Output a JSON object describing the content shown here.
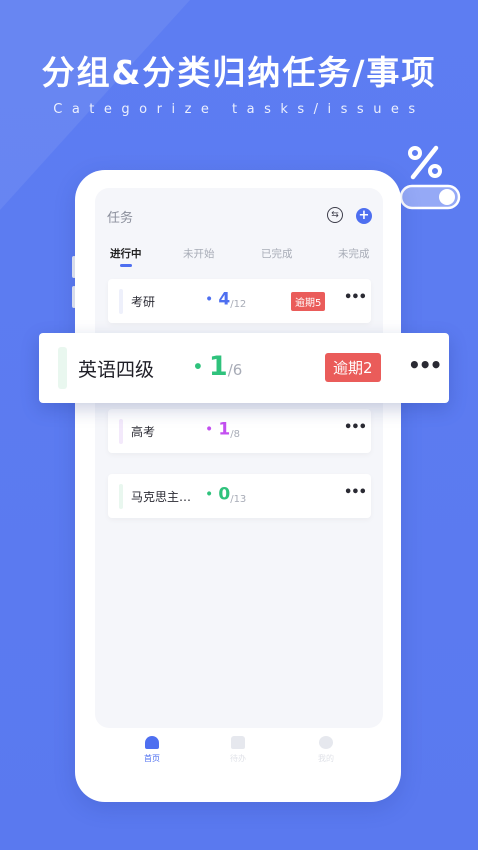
{
  "headline": "分组&分类归纳任务/事项",
  "subline": "Categorize tasks/issues",
  "decor_icon": "percent-toggle-icon",
  "app": {
    "title": "任务",
    "sync_icon": "sync-icon",
    "add_icon": "plus-icon",
    "tabs": [
      "进行中",
      "未开始",
      "已完成",
      "未完成"
    ],
    "active_tab": "进行中"
  },
  "tasks": [
    {
      "name": "考研",
      "done": "4",
      "total": "/12",
      "overdue": "逾期5",
      "accent": "#4e6ff0",
      "more": "•••"
    },
    {
      "name": "英语四级",
      "done": "1",
      "total": "/6",
      "overdue": "逾期2",
      "accent": "#2fc27c",
      "more": "•••"
    },
    {
      "name": "高考",
      "done": "1",
      "total": "/8",
      "overdue": "",
      "accent": "#c34ff0",
      "more": "•••"
    },
    {
      "name": "马克思主…",
      "done": "0",
      "total": "/13",
      "overdue": "",
      "accent": "#2fc27c",
      "more": "•••"
    }
  ],
  "nav": [
    {
      "label": "首页",
      "icon": "home-icon",
      "active": true
    },
    {
      "label": "待办",
      "icon": "todo-icon",
      "active": false
    },
    {
      "label": "我的",
      "icon": "profile-icon",
      "active": false
    }
  ],
  "colors": {
    "brand": "#5d7df2",
    "accent": "#4e6ff0",
    "overdue": "#ea5c5a",
    "bar_light_blue": "#eef0fb",
    "bar_light_green": "#e9f7ef",
    "bar_light_purple": "#f3e9fb"
  }
}
